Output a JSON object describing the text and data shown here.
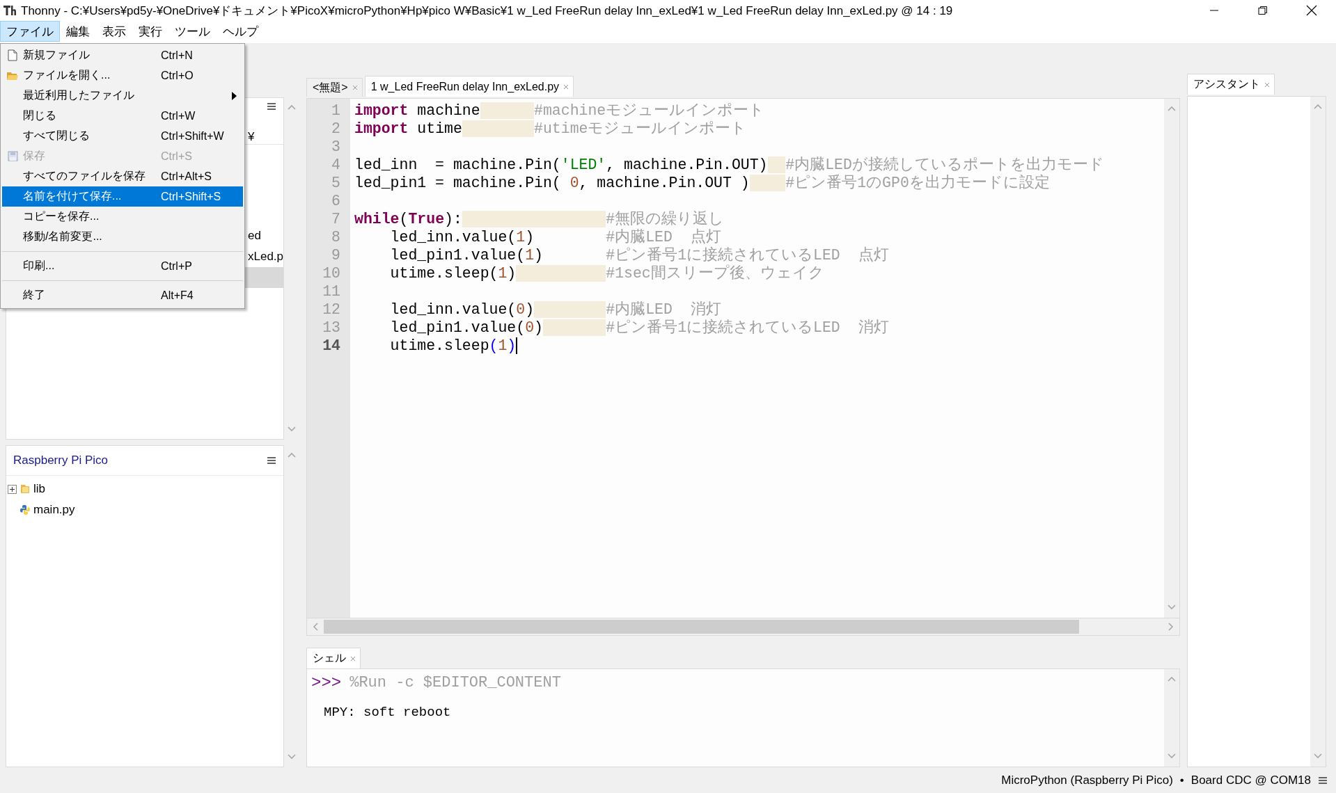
{
  "window": {
    "title": "Thonny  -  C:¥Users¥pd5y-¥OneDrive¥ドキュメント¥PicoX¥microPython¥Hp¥pico W¥Basic¥1 w_Led FreeRun delay Inn_exLed¥1 w_Led FreeRun delay Inn_exLed.py  @  14 : 19"
  },
  "menu_bar": [
    {
      "label": "ファイル",
      "selected": true
    },
    {
      "label": "編集",
      "selected": false
    },
    {
      "label": "表示",
      "selected": false
    },
    {
      "label": "実行",
      "selected": false
    },
    {
      "label": "ツール",
      "selected": false
    },
    {
      "label": "ヘルプ",
      "selected": false
    }
  ],
  "file_menu": [
    {
      "label": "新規ファイル",
      "shortcut": "Ctrl+N",
      "kind": "new",
      "disabled": false,
      "selected": false
    },
    {
      "label": "ファイルを開く...",
      "shortcut": "Ctrl+O",
      "kind": "open",
      "disabled": false,
      "selected": false
    },
    {
      "label": "最近利用したファイル",
      "submenu": true,
      "disabled": false,
      "selected": false
    },
    {
      "label": "閉じる",
      "shortcut": "Ctrl+W",
      "disabled": false,
      "selected": false
    },
    {
      "label": "すべて閉じる",
      "shortcut": "Ctrl+Shift+W",
      "disabled": false,
      "selected": false
    },
    {
      "label": "保存",
      "shortcut": "Ctrl+S",
      "kind": "save",
      "disabled": true,
      "selected": false
    },
    {
      "label": "すべてのファイルを保存",
      "shortcut": "Ctrl+Alt+S",
      "disabled": false,
      "selected": false
    },
    {
      "label": "名前を付けて保存...",
      "shortcut": "Ctrl+Shift+S",
      "disabled": false,
      "selected": true
    },
    {
      "label": "コピーを保存...",
      "disabled": false,
      "selected": false
    },
    {
      "label": "移動/名前変更...",
      "disabled": false,
      "selected": false
    },
    {
      "label": "印刷...",
      "shortcut": "Ctrl+P",
      "separator_before": true,
      "disabled": false,
      "selected": false
    },
    {
      "label": "終了",
      "shortcut": "Alt+F4",
      "separator_before": true,
      "disabled": false,
      "selected": false
    }
  ],
  "files_panel": {
    "path": "¥",
    "rows": [
      {
        "text": "ed",
        "selected": false
      },
      {
        "text": "xLed.p",
        "selected": false
      },
      {
        "selected": true
      }
    ]
  },
  "device_panel": {
    "title": "Raspberry Pi Pico",
    "tree": [
      {
        "name": "lib",
        "kind": "folder",
        "expanded": false
      },
      {
        "name": "main.py",
        "kind": "python"
      }
    ]
  },
  "editor": {
    "tabs": [
      {
        "label": "<無題>",
        "selected": false
      },
      {
        "label": "1 w_Led FreeRun delay Inn_exLed.py",
        "selected": true
      }
    ],
    "lines": [
      {
        "number": "1",
        "current": false,
        "segments": [
          {
            "kind": "keyword",
            "text": "import"
          },
          {
            "kind": "plain",
            "text": " machine\t\t"
          },
          {
            "kind": "comment",
            "text": "#machineモジュールインポート"
          }
        ]
      },
      {
        "number": "2",
        "current": false,
        "segments": [
          {
            "kind": "keyword",
            "text": "import"
          },
          {
            "kind": "plain",
            "text": " utime\t\t"
          },
          {
            "kind": "comment",
            "text": "#utimeモジュールインポート"
          }
        ]
      },
      {
        "number": "3",
        "current": false
      },
      {
        "number": "4",
        "current": false,
        "segments": [
          {
            "kind": "plain",
            "text": "led_inn  = machine.Pin("
          },
          {
            "kind": "string",
            "text": "'LED'"
          },
          {
            "kind": "plain",
            "text": ", machine.Pin.OUT)\t"
          },
          {
            "kind": "comment",
            "text": "#内臓LEDが接続しているポートを出力モード"
          }
        ]
      },
      {
        "number": "5",
        "current": false,
        "segments": [
          {
            "kind": "plain",
            "text": "led_pin1 = machine.Pin( "
          },
          {
            "kind": "number",
            "text": "0"
          },
          {
            "kind": "plain",
            "text": ", machine.Pin.OUT )\t"
          },
          {
            "kind": "comment",
            "text": "#ピン番号1のGP0を出力モードに設定"
          }
        ]
      },
      {
        "number": "6",
        "current": false
      },
      {
        "number": "7",
        "current": false,
        "segments": [
          {
            "kind": "keyword",
            "text": "while"
          },
          {
            "kind": "plain",
            "text": "("
          },
          {
            "kind": "keyword",
            "text": "True"
          },
          {
            "kind": "plain",
            "text": "):\t\t\t\t"
          },
          {
            "kind": "comment",
            "text": "#無限の繰り返し"
          }
        ]
      },
      {
        "number": "8",
        "current": false,
        "segments": [
          {
            "kind": "plain",
            "text": "    led_inn.value("
          },
          {
            "kind": "number",
            "text": "1"
          },
          {
            "kind": "plain",
            "text": ")        "
          },
          {
            "kind": "comment",
            "text": "#内臓LED  点灯"
          }
        ]
      },
      {
        "number": "9",
        "current": false,
        "segments": [
          {
            "kind": "plain",
            "text": "    led_pin1.value("
          },
          {
            "kind": "number",
            "text": "1"
          },
          {
            "kind": "plain",
            "text": ")       "
          },
          {
            "kind": "comment",
            "text": "#ピン番号1に接続されているLED  点灯"
          }
        ]
      },
      {
        "number": "10",
        "current": false,
        "segments": [
          {
            "kind": "plain",
            "text": "    utime.sleep("
          },
          {
            "kind": "number",
            "text": "1"
          },
          {
            "kind": "plain",
            "text": ")\t\t\t"
          },
          {
            "kind": "comment",
            "text": "#1sec間スリープ後、ウェイク"
          }
        ]
      },
      {
        "number": "11",
        "current": false
      },
      {
        "number": "12",
        "current": false,
        "segments": [
          {
            "kind": "plain",
            "text": "    led_inn.value("
          },
          {
            "kind": "number",
            "text": "0"
          },
          {
            "kind": "plain",
            "text": ")\t\t"
          },
          {
            "kind": "comment",
            "text": "#内臓LED  消灯"
          }
        ]
      },
      {
        "number": "13",
        "current": false,
        "segments": [
          {
            "kind": "plain",
            "text": "    led_pin1.value("
          },
          {
            "kind": "number",
            "text": "0"
          },
          {
            "kind": "plain",
            "text": ")\t\t"
          },
          {
            "kind": "comment",
            "text": "#ピン番号1に接続されているLED  消灯"
          }
        ]
      },
      {
        "number": "14",
        "current": true,
        "cursor": true,
        "segments": [
          {
            "kind": "plain",
            "text": "    utime.sleep"
          },
          {
            "kind": "bracket",
            "text": "("
          },
          {
            "kind": "number",
            "text": "1"
          },
          {
            "kind": "bracket",
            "text": ")"
          }
        ]
      }
    ]
  },
  "shell": {
    "tab": "シェル",
    "prompt": ">>>",
    "command": "%Run -c $EDITOR_CONTENT",
    "output": [
      "MPY: soft reboot"
    ]
  },
  "assistant": {
    "tab": "アシスタント"
  },
  "status_bar": {
    "interpreter": "MicroPython (Raspberry Pi Pico)",
    "separator": "•",
    "port": "Board CDC @ COM18"
  }
}
